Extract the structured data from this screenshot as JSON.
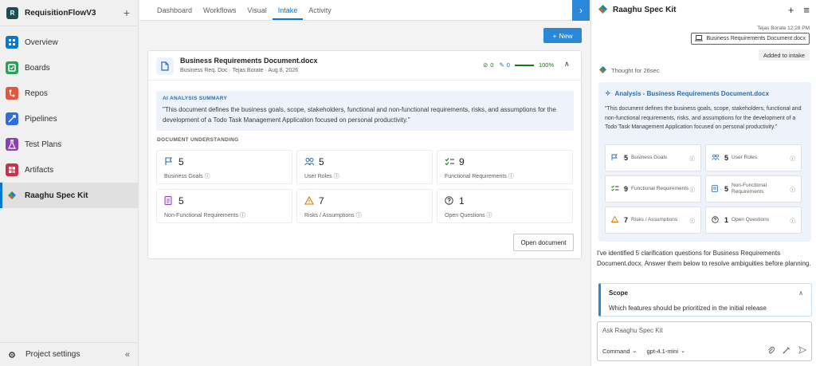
{
  "sidebar": {
    "project_badge": "R",
    "project_name": "RequisitionFlowV3",
    "items": [
      {
        "label": "Overview"
      },
      {
        "label": "Boards"
      },
      {
        "label": "Repos"
      },
      {
        "label": "Pipelines"
      },
      {
        "label": "Test Plans"
      },
      {
        "label": "Artifacts"
      },
      {
        "label": "Raaghu Spec Kit"
      }
    ],
    "footer_label": "Project settings"
  },
  "tabs": [
    "Dashboard",
    "Workflows",
    "Visual",
    "Intake",
    "Activity"
  ],
  "active_tab": "Intake",
  "main": {
    "new_label": "New",
    "doc": {
      "title": "Business Requirements Document.docx",
      "meta": "Business Req. Doc · Tejas Borate · Aug 8, 2026",
      "stat_check": "0",
      "stat_edit": "0",
      "progress_label": "100%",
      "progress_value": 1.0
    },
    "summary": {
      "title": "AI ANALYSIS SUMMARY",
      "text": "\"This document defines the business goals, scope, stakeholders, functional and non-functional requirements, risks, and assumptions for the development of a Todo Task Management Application focused on personal productivity.\""
    },
    "understanding_title": "DOCUMENT UNDERSTANDING",
    "metrics": [
      {
        "value": "5",
        "label": "Business Goals",
        "icon": "flag-icon"
      },
      {
        "value": "5",
        "label": "User Roles",
        "icon": "users-icon"
      },
      {
        "value": "9",
        "label": "Functional Requirements",
        "icon": "checklist-icon"
      },
      {
        "value": "5",
        "label": "Non-Functional Requirements",
        "icon": "document-icon"
      },
      {
        "value": "7",
        "label": "Risks / Assumptions",
        "icon": "warning-icon"
      },
      {
        "value": "1",
        "label": "Open Questions",
        "icon": "question-icon"
      }
    ],
    "open_document_label": "Open document"
  },
  "panel": {
    "title": "Raaghu Spec Kit",
    "msg_meta": "Tejas Borate 12:28 PM",
    "file_name": "Business Requirements Document.docx",
    "added_label": "Added to intake",
    "thought": "Thought for 26sec",
    "analysis_title": "Analysis - Business Requirements Document.docx",
    "analysis_text": "\"This document defines the business goals, scope, stakeholders, functional and non-functional requirements, risks, and assumptions for the development of a Todo Task Management Application focused on personal productivity.\"",
    "analysis_items": [
      {
        "value": "5",
        "label": "Business Goals"
      },
      {
        "value": "5",
        "label": "User Roles"
      },
      {
        "value": "9",
        "label": "Functional Requirements"
      },
      {
        "value": "5",
        "label": "Non-Functional Requirements"
      },
      {
        "value": "7",
        "label": "Risks / Assumptions"
      },
      {
        "value": "1",
        "label": "Open Questions"
      }
    ],
    "reply": "I've identified 5 clarification questions for Business Requirements Document.docx. Answer them below to resolve ambiguities before planning.",
    "scope_title": "Scope",
    "scope_question": "Which features should be prioritized in the initial release",
    "composer_placeholder": "Ask Raaghu Spec Kit",
    "mode": "Command",
    "model": "gpt-4.1-mini"
  },
  "colors": {
    "accent": "#2b88d8",
    "success": "#107c10",
    "summary_bg": "#eef3fb"
  }
}
